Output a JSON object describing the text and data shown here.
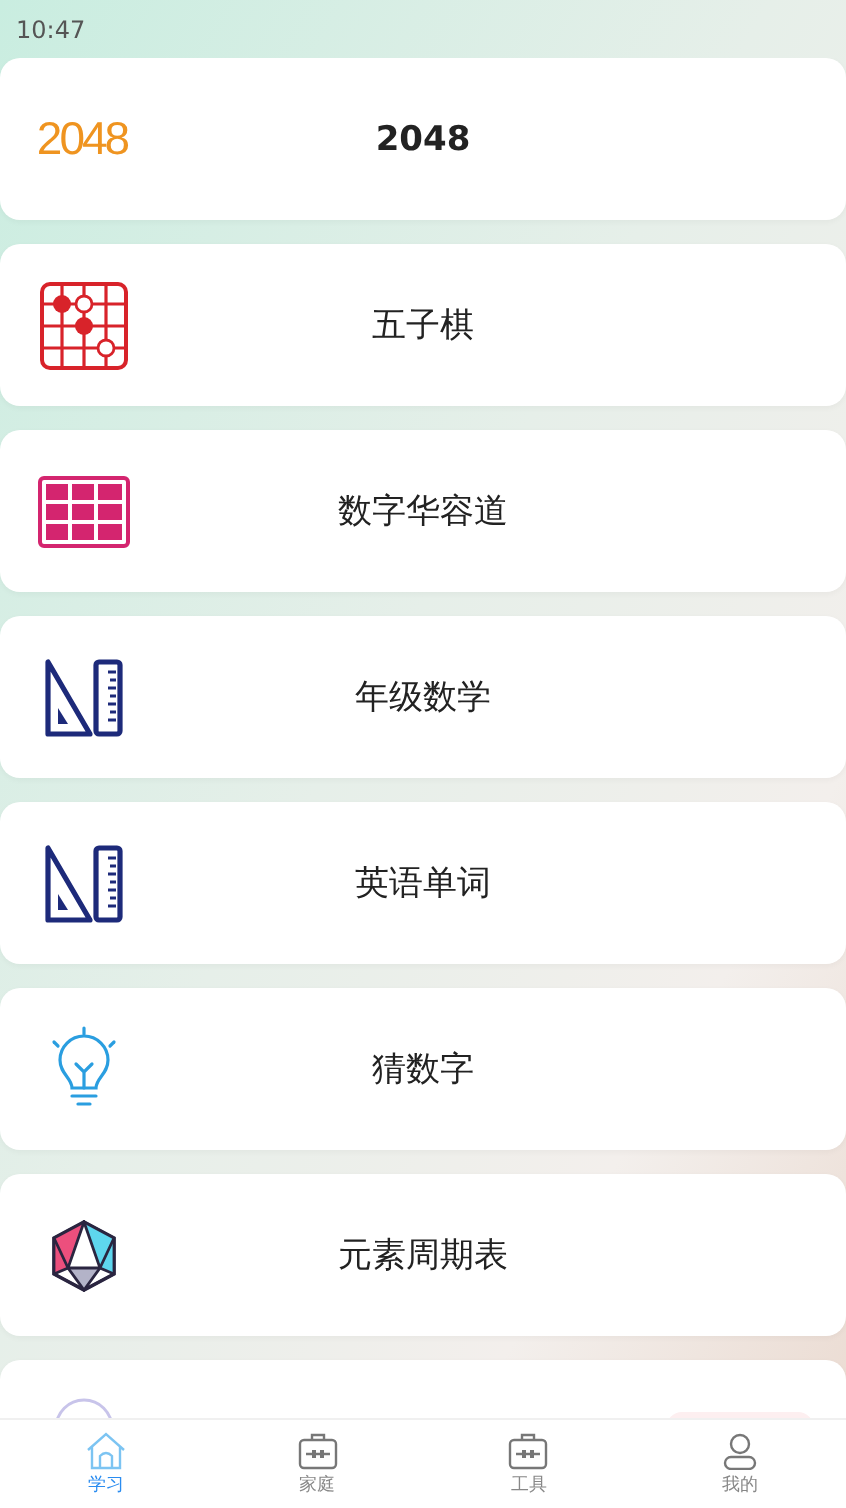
{
  "status_bar": {
    "time": "10:47"
  },
  "items": [
    {
      "title": "2048",
      "bold": true,
      "kind": "logo",
      "logo_text": "2048"
    },
    {
      "title": "五子棋",
      "bold": false,
      "kind": "gomoku"
    },
    {
      "title": "数字华容道",
      "bold": false,
      "kind": "grid"
    },
    {
      "title": "年级数学",
      "bold": false,
      "kind": "ruler"
    },
    {
      "title": "英语单词",
      "bold": false,
      "kind": "ruler"
    },
    {
      "title": "猜数字",
      "bold": false,
      "kind": "bulb"
    },
    {
      "title": "元素周期表",
      "bold": false,
      "kind": "gem"
    }
  ],
  "tabs": [
    {
      "label": "学习",
      "selected": true,
      "kind": "home"
    },
    {
      "label": "家庭",
      "selected": false,
      "kind": "case"
    },
    {
      "label": "工具",
      "selected": false,
      "kind": "case"
    },
    {
      "label": "我的",
      "selected": false,
      "kind": "user"
    }
  ]
}
